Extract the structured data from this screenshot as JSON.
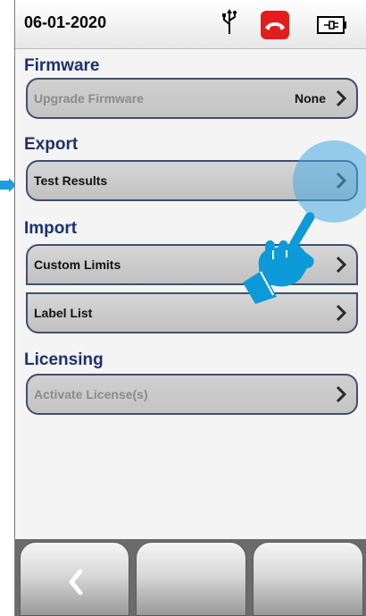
{
  "status": {
    "date": "06-01-2020"
  },
  "sections": {
    "firmware": {
      "title": "Firmware",
      "upgrade_label": "Upgrade Firmware",
      "upgrade_value": "None"
    },
    "export": {
      "title": "Export",
      "test_results_label": "Test Results"
    },
    "import": {
      "title": "Import",
      "custom_limits_label": "Custom Limits",
      "label_list_label": "Label List"
    },
    "licensing": {
      "title": "Licensing",
      "activate_label": "Activate License(s)"
    }
  },
  "colors": {
    "section_title": "#1d3170",
    "hang_up": "#e51c1c",
    "touch_hint": "#1a9ee0"
  },
  "icons": [
    "usb-icon",
    "hang-up-icon",
    "battery-power-icon",
    "chevron-right-icon",
    "back-icon",
    "pointing-hand-icon",
    "callout-arrow-icon"
  ]
}
